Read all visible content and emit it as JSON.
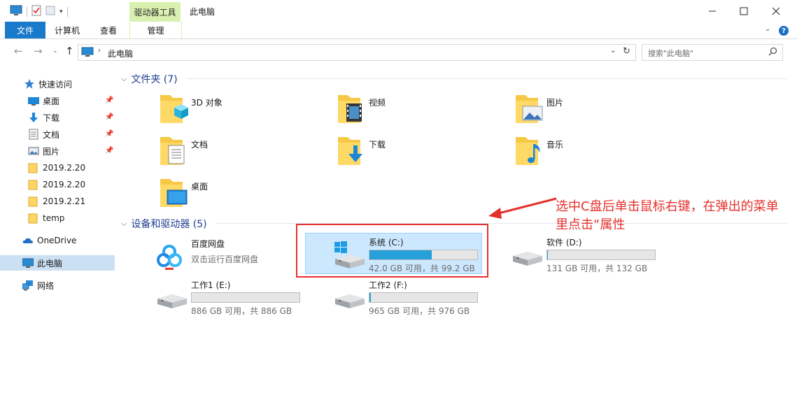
{
  "titlebar": {
    "context_tab_group": "驱动器工具",
    "window_title": "此电脑"
  },
  "ribbon": {
    "tabs": [
      {
        "label": "文件"
      },
      {
        "label": "计算机"
      },
      {
        "label": "查看"
      },
      {
        "label": "管理"
      }
    ]
  },
  "address": {
    "breadcrumb": "此电脑",
    "search_placeholder": "搜索\"此电脑\""
  },
  "nav_pane": {
    "items": [
      {
        "label": "快速访问",
        "icon": "star-icon"
      },
      {
        "label": "桌面",
        "icon": "desktop-icon",
        "pinned": true
      },
      {
        "label": "下载",
        "icon": "download-icon",
        "pinned": true
      },
      {
        "label": "文档",
        "icon": "document-icon",
        "pinned": true
      },
      {
        "label": "图片",
        "icon": "picture-icon",
        "pinned": true
      },
      {
        "label": "2019.2.20",
        "icon": "folder-icon"
      },
      {
        "label": "2019.2.20",
        "icon": "folder-icon"
      },
      {
        "label": "2019.2.21",
        "icon": "folder-icon"
      },
      {
        "label": "temp",
        "icon": "folder-icon"
      },
      {
        "label": "OneDrive",
        "icon": "cloud-icon"
      },
      {
        "label": "此电脑",
        "icon": "computer-icon",
        "selected": true
      },
      {
        "label": "网络",
        "icon": "network-icon"
      }
    ]
  },
  "folders_group": {
    "title": "文件夹 (7)",
    "items": [
      {
        "name": "3D 对象",
        "icon": "3d-objects-folder-icon"
      },
      {
        "name": "视频",
        "icon": "videos-folder-icon"
      },
      {
        "name": "图片",
        "icon": "pictures-folder-icon"
      },
      {
        "name": "文档",
        "icon": "documents-folder-icon"
      },
      {
        "name": "下载",
        "icon": "downloads-folder-icon"
      },
      {
        "name": "音乐",
        "icon": "music-folder-icon"
      },
      {
        "name": "桌面",
        "icon": "desktop-folder-icon"
      }
    ]
  },
  "devices_group": {
    "title": "设备和驱动器 (5)",
    "items": [
      {
        "name": "百度网盘",
        "subtitle": "双击运行百度网盘",
        "icon": "baidu-netdisk-icon"
      },
      {
        "name": "系统 (C:)",
        "info": "42.0 GB 可用，共 99.2 GB",
        "used_fraction": 0.577,
        "icon": "system-drive-icon",
        "selected": true
      },
      {
        "name": "软件 (D:)",
        "info": "131 GB 可用，共 132 GB",
        "used_fraction": 0.008,
        "icon": "hard-drive-icon"
      },
      {
        "name": "工作1 (E:)",
        "info": "886 GB 可用，共 886 GB",
        "used_fraction": 0.0,
        "icon": "hard-drive-icon"
      },
      {
        "name": "工作2 (F:)",
        "info": "965 GB 可用，共 976 GB",
        "used_fraction": 0.011,
        "icon": "hard-drive-icon"
      }
    ]
  },
  "annotation": {
    "text": "选中C盘后单击鼠标右键，在弹出的菜单里点击“属性",
    "color": "#e4302b"
  },
  "colors": {
    "accent": "#1979ca",
    "context_tab": "#d9f1b0",
    "selection": "#cce8ff",
    "drive_bar": "#26a0da"
  }
}
